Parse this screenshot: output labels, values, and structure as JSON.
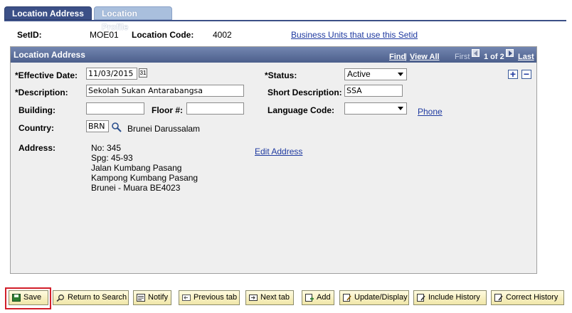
{
  "tabs": [
    {
      "label": "Location Address",
      "active": true
    },
    {
      "label": "Location Profile",
      "active": false
    }
  ],
  "header": {
    "setid_label": "SetID:",
    "setid_value": "MOE01",
    "location_code_label": "Location Code:",
    "location_code_value": "4002",
    "business_units_link": "Business Units that use this Setid"
  },
  "group": {
    "title": "Location Address",
    "find": "Find",
    "view_all": "View All",
    "separator": "|",
    "first": "First",
    "pager": "1 of 2",
    "last": "Last"
  },
  "form": {
    "effective_date_label": "*Effective Date:",
    "effective_date_value": "11/03/2015",
    "status_label": "*Status:",
    "status_value": "Active",
    "description_label": "*Description:",
    "description_value": "Sekolah Sukan Antarabangsa",
    "short_description_label": "Short Description:",
    "short_description_value": "SSA",
    "building_label": "Building:",
    "building_value": "",
    "floor_label": "Floor #:",
    "floor_value": "",
    "language_code_label": "Language Code:",
    "language_code_value": "",
    "phone_link": "Phone",
    "country_label": "Country:",
    "country_value": "BRN",
    "country_name": "Brunei Darussalam",
    "address_label": "Address:",
    "address_lines": [
      "No: 345",
      "Spg: 45-93",
      "Jalan Kumbang Pasang",
      "Kampong Kumbang Pasang",
      "Brunei - Muara BE4023"
    ],
    "edit_address_link": "Edit Address"
  },
  "toolbar": {
    "save": "Save",
    "return_to_search": "Return to Search",
    "notify": "Notify",
    "previous_tab": "Previous tab",
    "next_tab": "Next tab",
    "add": "Add",
    "update_display": "Update/Display",
    "include_history": "Include History",
    "correct_history": "Correct History"
  },
  "colors": {
    "tab_active": "#3c5087",
    "group_header": "#5b6e99",
    "link": "#1f3aa0",
    "highlight": "#d21f2a"
  }
}
